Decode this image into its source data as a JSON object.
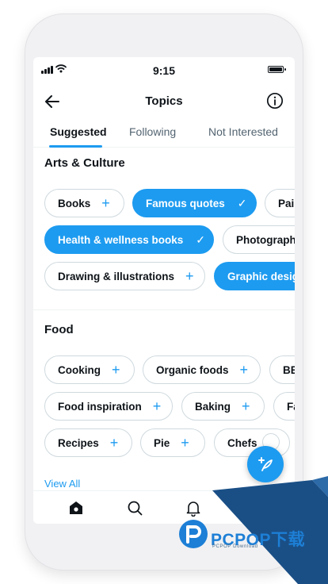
{
  "status_bar": {
    "time": "9:15"
  },
  "header": {
    "title": "Topics"
  },
  "tabs": [
    {
      "label": "Suggested",
      "active": true
    },
    {
      "label": "Following",
      "active": false
    },
    {
      "label": "Not Interested",
      "active": false
    }
  ],
  "sections": [
    {
      "title": "Arts & Culture",
      "chips": [
        {
          "label": "Books",
          "selected": false
        },
        {
          "label": "Famous quotes",
          "selected": true
        },
        {
          "label": "Pai",
          "selected": false
        },
        {
          "label": "Health & wellness books",
          "selected": true
        },
        {
          "label": "Photography",
          "selected": false
        },
        {
          "label": "Drawing & illustrations",
          "selected": false
        },
        {
          "label": "Graphic desig",
          "selected": true
        }
      ]
    },
    {
      "title": "Food",
      "chips": [
        {
          "label": "Cooking",
          "selected": false
        },
        {
          "label": "Organic foods",
          "selected": false
        },
        {
          "label": "BE",
          "selected": false
        },
        {
          "label": "Food inspiration",
          "selected": false
        },
        {
          "label": "Baking",
          "selected": false
        },
        {
          "label": "Fa",
          "selected": false
        },
        {
          "label": "Recipes",
          "selected": false
        },
        {
          "label": "Pie",
          "selected": false
        },
        {
          "label": "Chefs",
          "selected": false
        }
      ]
    }
  ],
  "view_all": "View All",
  "icons": {
    "plus": "+",
    "check": "✓",
    "names": [
      "back-arrow-icon",
      "info-icon",
      "compose-icon",
      "home-icon",
      "search-icon",
      "notifications-icon"
    ]
  },
  "watermark": {
    "brand": "PCPOP下载",
    "sub": "PCPOP Download"
  },
  "colors": {
    "accent": "#1d9bf0",
    "text": "#0f1419",
    "muted": "#536471",
    "border": "#cfd9de",
    "watermark": "#1d7fd6"
  }
}
